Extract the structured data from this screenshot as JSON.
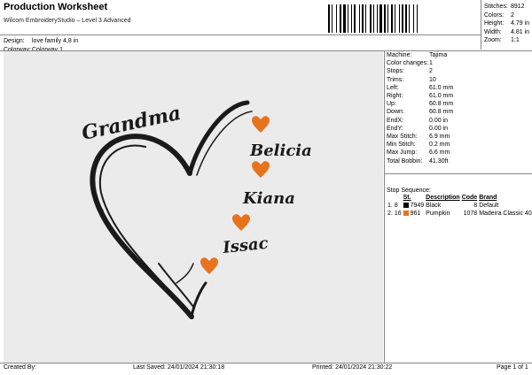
{
  "header": {
    "title": "Production Worksheet",
    "subtitle": "Wilcom EmbroideryStudio – Level 3 Advanced"
  },
  "stats": [
    {
      "label": "Stitches:",
      "value": "8912"
    },
    {
      "label": "Colors:",
      "value": "2"
    },
    {
      "label": "Height:",
      "value": "4.79 in"
    },
    {
      "label": "Width:",
      "value": "4.81 in"
    },
    {
      "label": "Zoom:",
      "value": "1:1"
    }
  ],
  "meta": [
    {
      "label": "Design:",
      "value": "love family 4,8 in"
    },
    {
      "label": "Colorway:",
      "value": "Colorway 1"
    }
  ],
  "design": {
    "text_top": "Grandma",
    "names": [
      "Belicia",
      "Kiana",
      "Issac"
    ],
    "colors": {
      "black": "#1a1a1a",
      "orange": "#e8731f",
      "background": "#ebebeb"
    }
  },
  "info": [
    {
      "label": "Machine:",
      "value": "Tajima"
    },
    {
      "label": "Color changes:",
      "value": "1"
    },
    {
      "label": "Stops:",
      "value": "2"
    },
    {
      "label": "Trims:",
      "value": "10"
    },
    {
      "label": "Left:",
      "value": "61.0 mm"
    },
    {
      "label": "Right:",
      "value": "61.0 mm"
    },
    {
      "label": "Up:",
      "value": "60.8 mm"
    },
    {
      "label": "Down:",
      "value": "60.8 mm"
    },
    {
      "label": "EndX:",
      "value": "0.00 in"
    },
    {
      "label": "EndY:",
      "value": "0.00 in"
    },
    {
      "label": "Max Stitch:",
      "value": "6.9 mm"
    },
    {
      "label": "Min Stitch:",
      "value": "0.2 mm"
    },
    {
      "label": "Max Jump:",
      "value": "6.6 mm"
    },
    {
      "label": "Total Bobbin:",
      "value": "41.30ft"
    }
  ],
  "stop_sequence": {
    "title": "Stop Sequence:",
    "headers": [
      "St.",
      "Description",
      "Code",
      "Brand"
    ],
    "rows": [
      {
        "n": "1.",
        "stop": "8",
        "swatch": "#000000",
        "st": "7949",
        "description": "Black",
        "code": "8",
        "brand": "Default"
      },
      {
        "n": "2.",
        "stop": "16",
        "swatch": "#e8731f",
        "st": "961",
        "description": "Pumpkin",
        "code": "1078",
        "brand": "Madeira Classic 40"
      }
    ]
  },
  "footer": {
    "created_by": "Created By:",
    "last_saved": "Last Saved: 24/01/2024 21:30:18",
    "printed": "Printed: 24/01/2024 21:30:22",
    "page": "Page 1 of 1"
  }
}
